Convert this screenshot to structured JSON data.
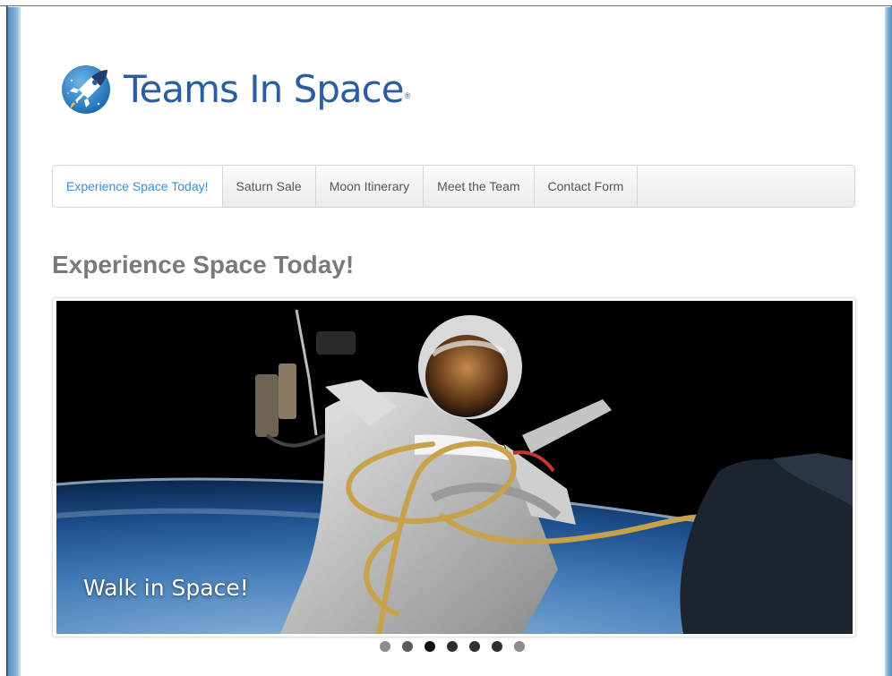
{
  "brand": {
    "name": "Teams In Space",
    "tm": "®",
    "color": "#2a5da2"
  },
  "nav": {
    "items": [
      {
        "label": "Experience Space Today!",
        "active": true
      },
      {
        "label": "Saturn Sale",
        "active": false
      },
      {
        "label": "Moon Itinerary",
        "active": false
      },
      {
        "label": "Meet the Team",
        "active": false
      },
      {
        "label": "Contact Form",
        "active": false
      }
    ],
    "active_color": "#3b8fd6"
  },
  "page": {
    "title": "Experience Space Today!"
  },
  "carousel": {
    "caption": "Walk in Space!",
    "slide_count": 7,
    "active_index": 2
  },
  "icons": {
    "logo": "rocket-planet-icon"
  }
}
